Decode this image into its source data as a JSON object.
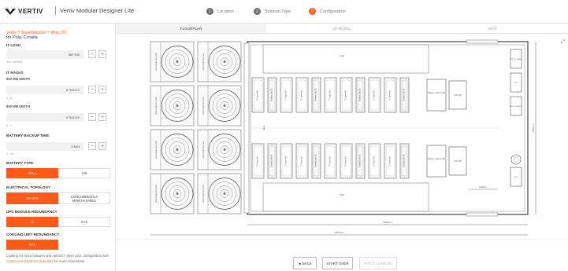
{
  "header": {
    "brand": "VERTIV",
    "title": "Vertiv Modular Designer Lite",
    "steps": [
      {
        "number": "1",
        "label": "Location",
        "active": false
      },
      {
        "number": "2",
        "label": "Solution Type",
        "active": false
      },
      {
        "number": "3",
        "label": "Configuration",
        "active": true
      }
    ]
  },
  "sidebar": {
    "project_name": "Vertiv™ SmartSolution™ Mod. DX",
    "location": "for Pula, Croatia",
    "it_load": {
      "label": "IT LOAD",
      "value": "560 KW",
      "range": "300-1500KW"
    },
    "it_racks": {
      "label": "IT RACKS"
    },
    "rack_600": {
      "label": "600 MM WIDTH",
      "value": "0 RACKS",
      "range": "0 - 8"
    },
    "rack_800": {
      "label": "800 MM WIDTH",
      "value": "0 RACKS",
      "range": "0 - 0"
    },
    "backup": {
      "label": "BATTERY BACKUP TIME",
      "value": "5 MIN",
      "range": "5 - 10"
    },
    "battery_type": {
      "label": "BATTERY TYPE",
      "options": [
        "VRLA",
        "LIB"
      ],
      "selected": 0
    },
    "topology": {
      "label": "ELECTRICAL TOPOLOGY",
      "options": [
        "2N UPS",
        "CONCURRENTLY MAINTAINABLE"
      ],
      "selected": 0
    },
    "ups_redundancy": {
      "label": "UPS MODULE REDUNDANCY",
      "options": [
        "N",
        "N+1"
      ],
      "selected": 0
    },
    "cooling_redundancy": {
      "label": "COOLING UNIT REDUNDANCY",
      "options": [
        "N+1"
      ],
      "selected": 0
    },
    "plus": "+",
    "minus": "−",
    "footnote_1": "Looking for more features and options? Save your configuration and",
    "footnote_link": "contact our Solutions Specialist",
    "footnote_2": "for more information."
  },
  "tabs": [
    "FLOORPLAN",
    "3D MODEL",
    "INFO"
  ],
  "active_tab": 0,
  "actions": {
    "back": "◄ BACK",
    "start_over": "START OVER",
    "apply": "APPLY CHANGES"
  },
  "floorplan": {
    "outdoor_unit_label": "Heat Rejection Unit",
    "outdoor_units": 8,
    "aisle_label": "Aisle",
    "upper_row": [
      "IT Rack 48U",
      "Cooling Unit 30",
      "IT Rack 48U",
      "IT Rack 48U",
      "Cooling Unit 30",
      "IT Rack 48U",
      "IT Rack 48U",
      "Cooling Unit 30",
      "IT Rack 48U",
      "IT Rack 48U",
      "Cooling Unit 30"
    ],
    "lower_row": [
      "IT Rack 48U",
      "Cooling Unit 30",
      "IT Rack 48U",
      "IT Rack 48U",
      "Cooling Unit 30",
      "IT Rack 48U",
      "IT Rack 48U",
      "Cooling Unit 30",
      "IT Rack 48U",
      "IT Rack 48U",
      "Cooling Unit 30"
    ],
    "battery_label": "Battery Cabinet 4B",
    "ups_label": "UPS 4B",
    "right_panels": [
      "UTILITY PANEL",
      "PDU",
      "UPS CONSOLE",
      "PDU"
    ],
    "left_door": "Entrance",
    "right_door": "Door",
    "dim_inner": "9050mm",
    "dim_outer": "12070mm",
    "dim_height": "5080mm",
    "dim_door": "1000mm"
  }
}
